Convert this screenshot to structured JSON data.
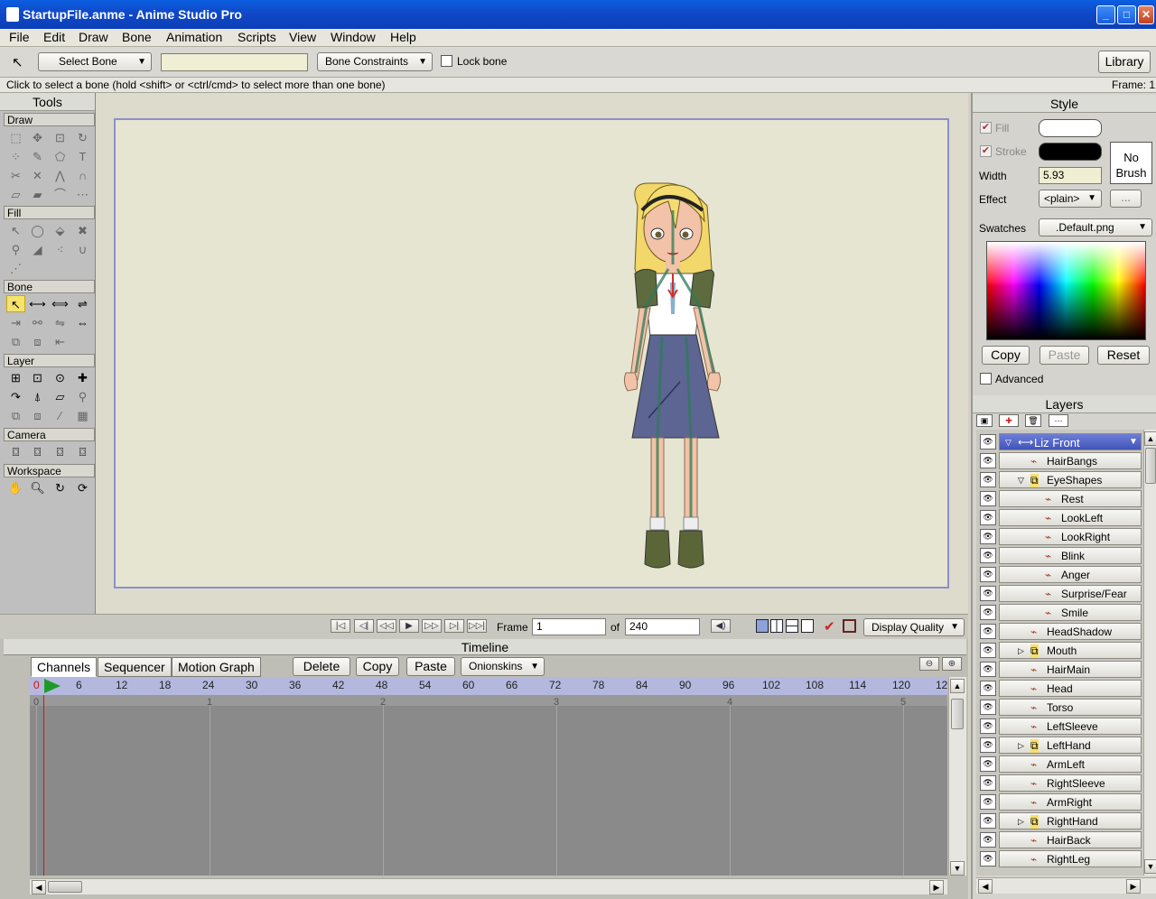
{
  "window": {
    "title": "StartupFile.anme - Anime Studio Pro"
  },
  "menu": [
    "File",
    "Edit",
    "Draw",
    "Bone",
    "Animation",
    "Scripts",
    "View",
    "Window",
    "Help"
  ],
  "toolbar": {
    "tool_mode": "Select Bone",
    "name_field": "",
    "constraints_label": "Bone Constraints",
    "lock_bone_label": "Lock bone",
    "library_label": "Library"
  },
  "status": {
    "hint": "Click to select a bone (hold <shift> or <ctrl/cmd> to select more than one bone)",
    "frame": "Frame: 1"
  },
  "tools": {
    "title": "Tools",
    "sections": {
      "draw": "Draw",
      "fill": "Fill",
      "bone": "Bone",
      "layer": "Layer",
      "camera": "Camera",
      "workspace": "Workspace"
    }
  },
  "playback": {
    "frame_label": "Frame",
    "frame_value": "1",
    "of_label": "of",
    "total_frames": "240",
    "display_quality": "Display Quality"
  },
  "timeline": {
    "title": "Timeline",
    "tabs": [
      "Channels",
      "Sequencer",
      "Motion Graph"
    ],
    "actions": {
      "delete": "Delete",
      "copy": "Copy",
      "paste": "Paste",
      "onionskins": "Onionskins"
    },
    "ruler_ticks": [
      "0",
      "6",
      "12",
      "18",
      "24",
      "30",
      "36",
      "42",
      "48",
      "54",
      "60",
      "66",
      "72",
      "78",
      "84",
      "90",
      "96",
      "102",
      "108",
      "114",
      "120",
      "12"
    ],
    "seconds": [
      "0",
      "1",
      "2",
      "3",
      "4",
      "5"
    ]
  },
  "style": {
    "title": "Style",
    "fill_label": "Fill",
    "stroke_label": "Stroke",
    "width_label": "Width",
    "width_value": "5.93",
    "effect_label": "Effect",
    "effect_value": "<plain>",
    "more_label": "...",
    "brush_label": "No Brush",
    "swatches_label": "Swatches",
    "swatches_value": ".Default.png",
    "copy": "Copy",
    "paste": "Paste",
    "reset": "Reset",
    "advanced": "Advanced",
    "fill_color": "#ffffff",
    "stroke_color": "#000000"
  },
  "layers": {
    "title": "Layers",
    "items": [
      {
        "name": "Liz Front",
        "depth": 0,
        "kind": "bone",
        "selected": true
      },
      {
        "name": "HairBangs",
        "depth": 1,
        "kind": "vector"
      },
      {
        "name": "EyeShapes",
        "depth": 1,
        "kind": "switch",
        "expanded": true
      },
      {
        "name": "Rest",
        "depth": 2,
        "kind": "vector"
      },
      {
        "name": "LookLeft",
        "depth": 2,
        "kind": "vector"
      },
      {
        "name": "LookRight",
        "depth": 2,
        "kind": "vector"
      },
      {
        "name": "Blink",
        "depth": 2,
        "kind": "vector"
      },
      {
        "name": "Anger",
        "depth": 2,
        "kind": "vector"
      },
      {
        "name": "Surprise/Fear",
        "depth": 2,
        "kind": "vector"
      },
      {
        "name": "Smile",
        "depth": 2,
        "kind": "vector"
      },
      {
        "name": "HeadShadow",
        "depth": 1,
        "kind": "vector"
      },
      {
        "name": "Mouth",
        "depth": 1,
        "kind": "switch",
        "collapsed": true
      },
      {
        "name": "HairMain",
        "depth": 1,
        "kind": "vector"
      },
      {
        "name": "Head",
        "depth": 1,
        "kind": "vector"
      },
      {
        "name": "Torso",
        "depth": 1,
        "kind": "vector"
      },
      {
        "name": "LeftSleeve",
        "depth": 1,
        "kind": "vector"
      },
      {
        "name": "LeftHand",
        "depth": 1,
        "kind": "switch",
        "collapsed": true
      },
      {
        "name": "ArmLeft",
        "depth": 1,
        "kind": "vector"
      },
      {
        "name": "RightSleeve",
        "depth": 1,
        "kind": "vector"
      },
      {
        "name": "ArmRight",
        "depth": 1,
        "kind": "vector"
      },
      {
        "name": "RightHand",
        "depth": 1,
        "kind": "switch",
        "collapsed": true
      },
      {
        "name": "HairBack",
        "depth": 1,
        "kind": "vector"
      },
      {
        "name": "RightLeg",
        "depth": 1,
        "kind": "vector"
      }
    ]
  },
  "colors": {
    "selection": "#4a5cc0",
    "accent": "#1048c8",
    "playhead": "#e01010"
  }
}
